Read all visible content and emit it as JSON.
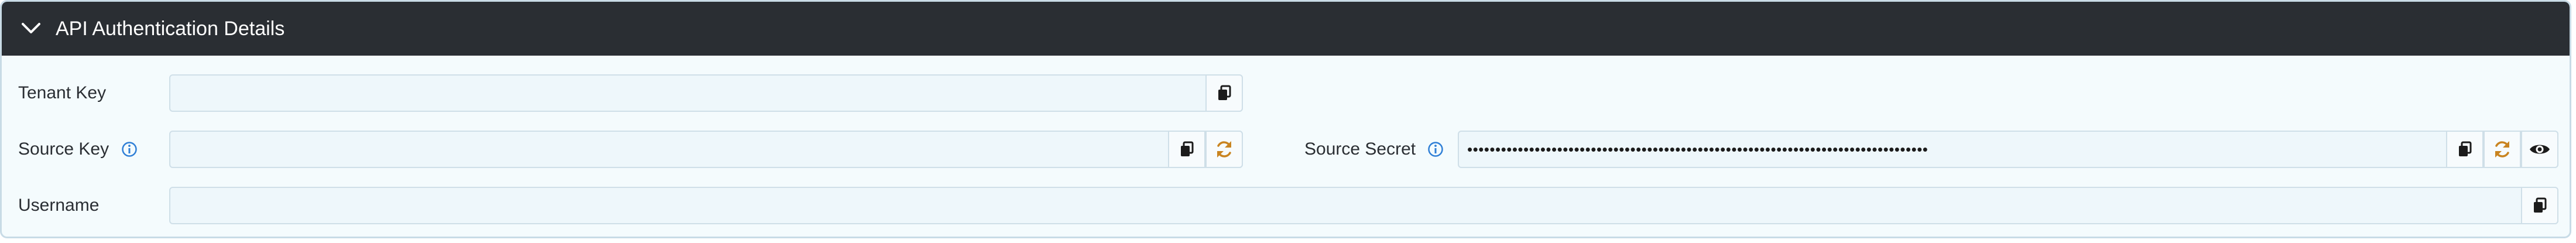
{
  "panel": {
    "title": "API Authentication Details",
    "expanded": true
  },
  "fields": {
    "tenant_key": {
      "label": "Tenant Key",
      "value": ""
    },
    "source_key": {
      "label": "Source Key",
      "value": ""
    },
    "source_secret": {
      "label": "Source Secret",
      "value": "••••••••••••••••••••••••••••••••••••••••••••••••••••••••••••••••••••••••••••••••••"
    },
    "username": {
      "label": "Username",
      "value": ""
    }
  },
  "icons": {
    "collapse": "chevron-down-icon",
    "info": "info-icon",
    "copy": "copy-icon",
    "regenerate": "refresh-icon",
    "reveal": "eye-icon"
  },
  "colors": {
    "header_bg": "#2a2e33",
    "panel_bg": "#f4fbfd",
    "info_blue": "#2f7fd6",
    "refresh_orange": "#c98420"
  }
}
